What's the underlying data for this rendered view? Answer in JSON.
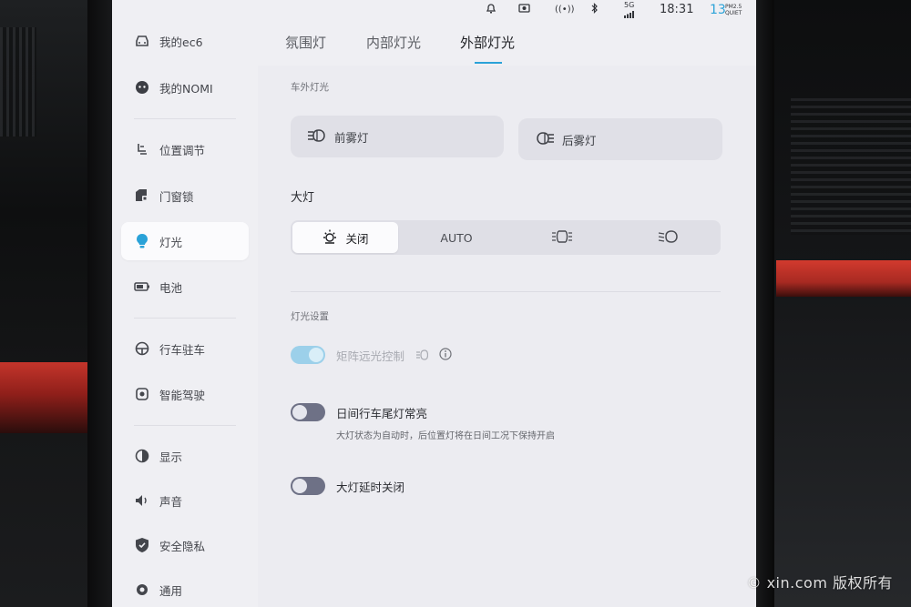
{
  "status_bar": {
    "time": "18:31",
    "aqi_value": "13",
    "aqi_label": "PM2.5",
    "aqi_quiet": "QUIET",
    "signal": "5G"
  },
  "sidebar": {
    "items": [
      {
        "label": "我的ec6",
        "icon": "car-icon"
      },
      {
        "label": "我的NOMI",
        "icon": "nomi-icon"
      },
      {
        "label": "位置调节",
        "icon": "seat-icon"
      },
      {
        "label": "门窗锁",
        "icon": "door-lock-icon"
      },
      {
        "label": "灯光",
        "icon": "bulb-icon",
        "active": true
      },
      {
        "label": "电池",
        "icon": "battery-icon"
      },
      {
        "label": "行车驻车",
        "icon": "steering-wheel-icon"
      },
      {
        "label": "智能驾驶",
        "icon": "assist-driving-icon"
      },
      {
        "label": "显示",
        "icon": "display-icon"
      },
      {
        "label": "声音",
        "icon": "speaker-icon"
      },
      {
        "label": "安全隐私",
        "icon": "shield-icon"
      },
      {
        "label": "通用",
        "icon": "gear-icon"
      }
    ]
  },
  "tabs": [
    {
      "label": "氛围灯"
    },
    {
      "label": "内部灯光"
    },
    {
      "label": "外部灯光",
      "active": true
    }
  ],
  "exterior": {
    "section_label": "车外灯光",
    "front_fog": "前雾灯",
    "rear_fog": "后雾灯"
  },
  "headlights": {
    "heading": "大灯",
    "options": [
      {
        "label": "关闭",
        "icon": "sun-off-icon",
        "active": true
      },
      {
        "label": "AUTO"
      },
      {
        "label": "",
        "icon": "position-light-icon"
      },
      {
        "label": "",
        "icon": "low-beam-icon"
      }
    ]
  },
  "settings": {
    "section_label": "灯光设置",
    "matrix_label": "矩阵远光控制",
    "matrix_on": true,
    "drl_label": "日间行车尾灯常亮",
    "drl_desc": "大灯状态为自动时，后位置灯将在日间工况下保持开启",
    "drl_on": false,
    "delay_label": "大灯延时关闭",
    "delay_on": false
  },
  "watermark": "© xin.com  版权所有",
  "colors": {
    "accent": "#2aa2d8",
    "toggle_off": "#6e7186",
    "toggle_on_disabled": "#9cd0ea",
    "bulb_active": "#2aa2d8"
  }
}
